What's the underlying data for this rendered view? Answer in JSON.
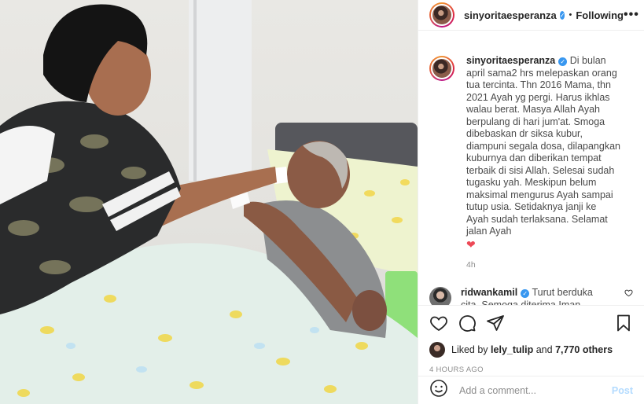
{
  "post": {
    "username": "sinyoritaesperanza",
    "follow_label": "Following",
    "separator": "•",
    "more_label": "•••",
    "verified_glyph": "✓"
  },
  "caption": {
    "username": "sinyoritaesperanza",
    "text": "Di bulan april sama2 hrs melepaskan orang tua tercinta. Thn 2016 Mama, thn 2021 Ayah yg pergi. Harus ikhlas walau berat. Masya Allah Ayah berpulang di hari jum'at. Smoga dibebaskan dr siksa kubur, diampuni segala dosa, dilapangkan kuburnya dan diberikan tempat terbaik di sisi Allah. Selesai sudah tugasku yah. Meskipun belum maksimal mengurus Ayah sampai tutup usia. Setidaknya janji ke Ayah sudah terlaksana. Selamat jalan Ayah",
    "emoji": "❤",
    "time": "4h"
  },
  "comments": [
    {
      "username": "ridwankamil",
      "text": "Turut berduka cita. Semoga diterima Iman Islamnya. Dan semua diberi"
    }
  ],
  "actions": {
    "like_icon": "heart-outline-icon",
    "comment_icon": "comment-bubble-icon",
    "share_icon": "paper-plane-icon",
    "save_icon": "bookmark-icon"
  },
  "likes": {
    "prefix": "Liked by",
    "user": "lely_tulip",
    "and": "and",
    "count": "7,770 others"
  },
  "timestamp": "4 HOURS AGO",
  "add_comment": {
    "placeholder": "Add a comment...",
    "post_label": "Post"
  }
}
